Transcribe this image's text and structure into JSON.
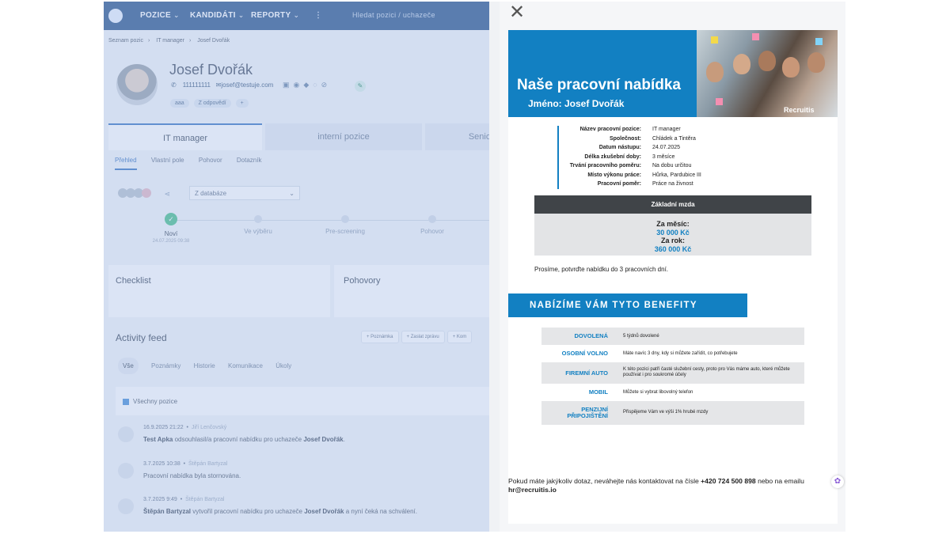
{
  "app": {
    "nav": {
      "positions": "POZICE",
      "candidates": "KANDIDÁTI",
      "reports": "REPORTY",
      "search_placeholder": "Hledat pozici / uchazeče"
    },
    "breadcrumbs": [
      "Seznam pozic",
      "IT manager",
      "Josef Dvořák"
    ],
    "candidate": {
      "name": "Josef Dvořák",
      "phone": "111111111",
      "email": "josef@testuje.com",
      "tags": [
        "aaa",
        "Z odpovědí",
        "+"
      ]
    },
    "position_tabs": [
      "IT manager",
      "interní pozice",
      "Senior J"
    ],
    "subtabs": [
      "Přehled",
      "Vlastní pole",
      "Pohovor",
      "Dotazník"
    ],
    "source_select": "Z databáze",
    "pipeline": [
      {
        "label": "Noví",
        "date": "24.07.2025 09:38",
        "done": true
      },
      {
        "label": "Ve výběru",
        "date": "",
        "done": false
      },
      {
        "label": "Pre-screening",
        "date": "",
        "done": false
      },
      {
        "label": "Pohovor",
        "date": "",
        "done": false
      }
    ],
    "cards": [
      "Checklist",
      "Pohovory"
    ],
    "feed": {
      "title": "Activity feed",
      "buttons": [
        "+ Poznámka",
        "+ Zaslat zprávu",
        "+ Kom"
      ],
      "tabs": [
        "Vše",
        "Poznámky",
        "Historie",
        "Komunikace",
        "Úkoly"
      ],
      "filter": "Všechny pozice",
      "items": [
        {
          "date": "16.9.2025 21:22",
          "who": "Jiří Lenčovský",
          "parts": [
            "Test Apka",
            " odsouhlasil/a pracovní nabídku pro uchazeče ",
            "Josef Dvořák",
            "."
          ]
        },
        {
          "date": "3.7.2025 10:38",
          "who": "Štěpán Bartyzal",
          "parts": [
            "",
            "Pracovní nabídka byla stornována.",
            "",
            ""
          ]
        },
        {
          "date": "3.7.2025 9:49",
          "who": "Štěpán Bartyzal",
          "parts": [
            "Štěpán Bartyzal",
            " vytvořil pracovní nabídku pro uchazeče ",
            "Josef Dvořák",
            " a nyní čeká na schválení."
          ]
        }
      ]
    }
  },
  "offer": {
    "close_icon": "close-icon",
    "title": "Naše pracovní nabídka",
    "subtitle": "Jméno: Josef Dvořák",
    "brand": "Recruitis",
    "details": [
      {
        "k": "Název pracovní pozice:",
        "v": "IT manager"
      },
      {
        "k": "Společnost:",
        "v": "Chládek a Tintěra"
      },
      {
        "k": "Datum nástupu:",
        "v": "24.07.2025"
      },
      {
        "k": "Délka zkušební doby:",
        "v": "3 měsíce"
      },
      {
        "k": "Trvání pracovního poměru:",
        "v": "Na dobu určitou"
      },
      {
        "k": "Místo výkonu práce:",
        "v": "Hůrka, Pardubice III"
      },
      {
        "k": "Pracovní poměr:",
        "v": "Práce na živnost"
      }
    ],
    "salary": {
      "header": "Základní mzda",
      "month_label": "Za měsíc:",
      "month_value": "30 000 Kč",
      "year_label": "Za rok:",
      "year_value": "360 000 Kč"
    },
    "confirm_text": "Prosíme, potvrďte nabídku do 3 pracovních dní.",
    "benefits_title": "NABÍZÍME VÁM TYTO BENEFITY",
    "benefits": [
      {
        "k": "DOVOLENÁ",
        "v": "5 týdnů dovolené"
      },
      {
        "k": "OSOBNÍ VOLNO",
        "v": "Máte navíc 3 dny, kdy si můžete zařídit, co potřebujete"
      },
      {
        "k": "FIREMNÍ AUTO",
        "v": "K této pozici patří časté služební cesty, proto pro Vás máme auto, které můžete používat i pro soukromé účely"
      },
      {
        "k": "MOBIL",
        "v": "Můžete si vybrat libovolný telefon"
      },
      {
        "k": "PENZIJNÍ PŘIPOJIŠTĚNÍ",
        "v": "Přispějeme Vám ve výši 1% hrubé mzdy"
      }
    ],
    "footer": {
      "pre": "Pokud máte jakýkoliv dotaz, neváhejte nás kontaktovat na čísle ",
      "phone": "+420 724 500 898",
      "mid": " nebo na emailu ",
      "email": "hr@recruitis.io"
    }
  },
  "colors": {
    "accent": "#1280c2",
    "nav": "#2f5a8f",
    "salary_header": "#404448"
  }
}
